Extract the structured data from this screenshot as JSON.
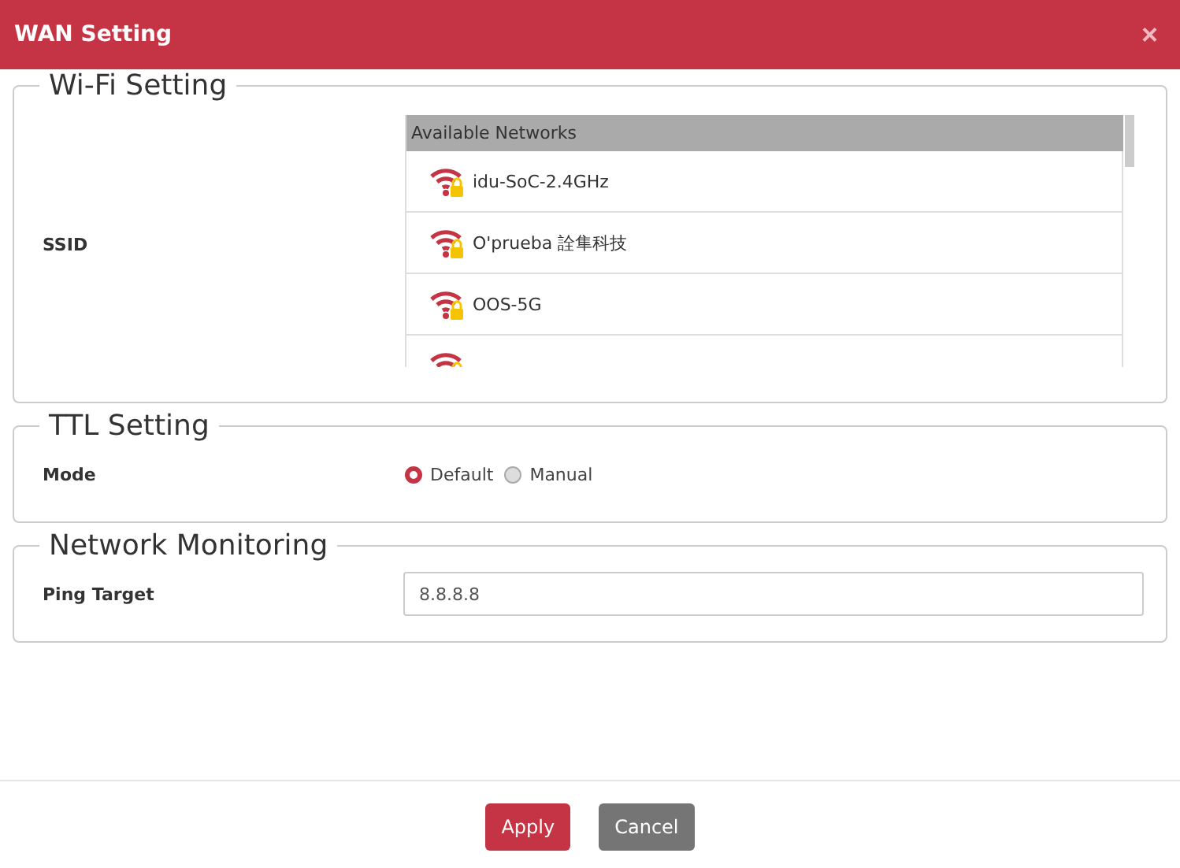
{
  "window": {
    "title": "WAN Setting",
    "close": "×"
  },
  "wifi": {
    "legend": "Wi-Fi Setting",
    "label": "SSID",
    "list_header": "Available Networks",
    "networks": [
      {
        "name": "idu-SoC-2.4GHz",
        "locked": true
      },
      {
        "name": "O'prueba 詮隼科技",
        "locked": true
      },
      {
        "name": "OOS-5G",
        "locked": true
      },
      {
        "locked": true
      }
    ]
  },
  "ttl": {
    "legend": "TTL Setting",
    "label": "Mode",
    "options": [
      {
        "label": "Default",
        "selected": true
      },
      {
        "label": "Manual",
        "selected": false
      }
    ]
  },
  "monitoring": {
    "legend": "Network Monitoring",
    "label": "Ping Target",
    "value": "8.8.8.8"
  },
  "buttons": [
    {
      "label": "Apply",
      "kind": "primary"
    },
    {
      "label": "Cancel",
      "kind": "secondary"
    }
  ]
}
